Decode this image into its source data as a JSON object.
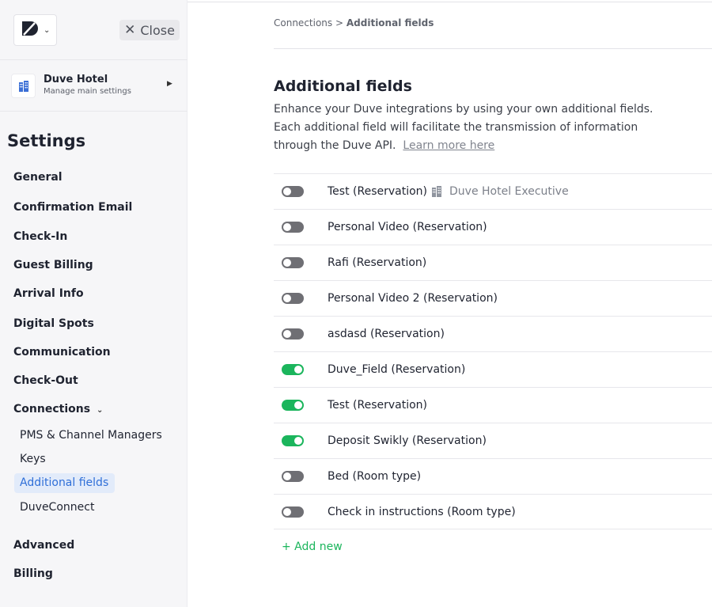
{
  "sidebar": {
    "close_label": "Close",
    "hotel": {
      "name": "Duve Hotel",
      "subtitle": "Manage main settings"
    },
    "title": "Settings",
    "nav": {
      "general": "General",
      "confirmation_email": "Confirmation Email",
      "check_in": "Check-In",
      "guest_billing": "Guest Billing",
      "arrival_info": "Arrival Info",
      "digital_spots": "Digital Spots",
      "communication": "Communication",
      "check_out": "Check-Out",
      "connections": "Connections",
      "advanced": "Advanced",
      "billing": "Billing"
    },
    "connections_sub": {
      "pms": "PMS & Channel Managers",
      "keys": "Keys",
      "additional_fields": "Additional fields",
      "duveconnect": "DuveConnect"
    }
  },
  "breadcrumb": {
    "parent": "Connections",
    "separator": ">",
    "current": "Additional fields"
  },
  "page": {
    "title": "Additional fields",
    "description": "Enhance your Duve integrations by using your own additional fields. Each additional field will facilitate the transmission of information through the Duve API.",
    "learn_more": "Learn more here"
  },
  "fields": [
    {
      "label": "Test (Reservation)",
      "enabled": false,
      "property": "Duve Hotel Executive"
    },
    {
      "label": "Personal Video (Reservation)",
      "enabled": false
    },
    {
      "label": "Rafi (Reservation)",
      "enabled": false
    },
    {
      "label": "Personal Video 2 (Reservation)",
      "enabled": false
    },
    {
      "label": "asdasd (Reservation)",
      "enabled": false
    },
    {
      "label": "Duve_Field (Reservation)",
      "enabled": true
    },
    {
      "label": "Test (Reservation)",
      "enabled": true
    },
    {
      "label": "Deposit Swikly (Reservation)",
      "enabled": true
    },
    {
      "label": "Bed (Room type)",
      "enabled": false
    },
    {
      "label": "Check in instructions (Room type)",
      "enabled": false
    }
  ],
  "add_new_label": "+ Add new",
  "colors": {
    "accent_green": "#1bb55c",
    "active_blue": "#2f6fd8",
    "toggle_off": "#6f6f74"
  },
  "icons": [
    "duve-logo-icon",
    "chevron-down-icon",
    "close-icon",
    "building-icon",
    "chevron-right-icon"
  ]
}
